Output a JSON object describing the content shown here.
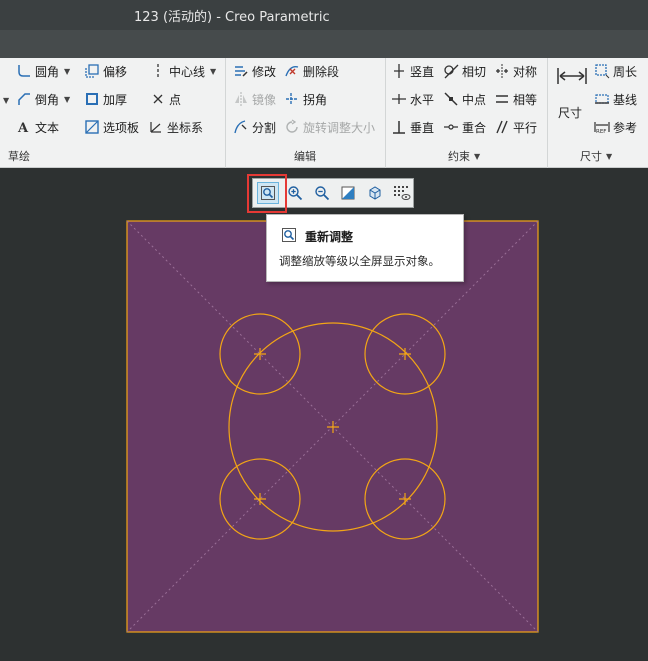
{
  "window": {
    "title": "123 (活动的) - Creo Parametric"
  },
  "ribbon": {
    "sketch_group": {
      "label": "草绘",
      "items": {
        "fillet": "圆角",
        "offset": "偏移",
        "centerline": "中心线",
        "chamfer": "倒角",
        "thicken": "加厚",
        "point": "点",
        "text": "文本",
        "palette": "选项板",
        "coord_sys": "坐标系"
      }
    },
    "edit_group": {
      "label": "编辑",
      "items": {
        "modify": "修改",
        "delete_segment": "删除段",
        "mirror": "镜像",
        "corner": "拐角",
        "divide": "分割",
        "rotate_resize": "旋转调整大小"
      }
    },
    "constrain_group": {
      "label": "约束",
      "items": {
        "vertical": "竖直",
        "tangent": "相切",
        "symmetric": "对称",
        "horizontal": "水平",
        "midpoint": "中点",
        "equal": "相等",
        "perpendicular": "垂直",
        "coincident": "重合",
        "parallel": "平行"
      }
    },
    "dimension_group": {
      "label": "尺寸",
      "items": {
        "dimension": "尺寸",
        "perimeter": "周长",
        "baseline": "基线",
        "reference": "参考"
      }
    }
  },
  "tooltip": {
    "title": "重新调整",
    "description": "调整缩放等级以全屏显示对象。"
  },
  "colors": {
    "sketch_background": "#663a64",
    "sketch_geometry": "#f2a516",
    "toolbar_highlight": "#e53935"
  }
}
